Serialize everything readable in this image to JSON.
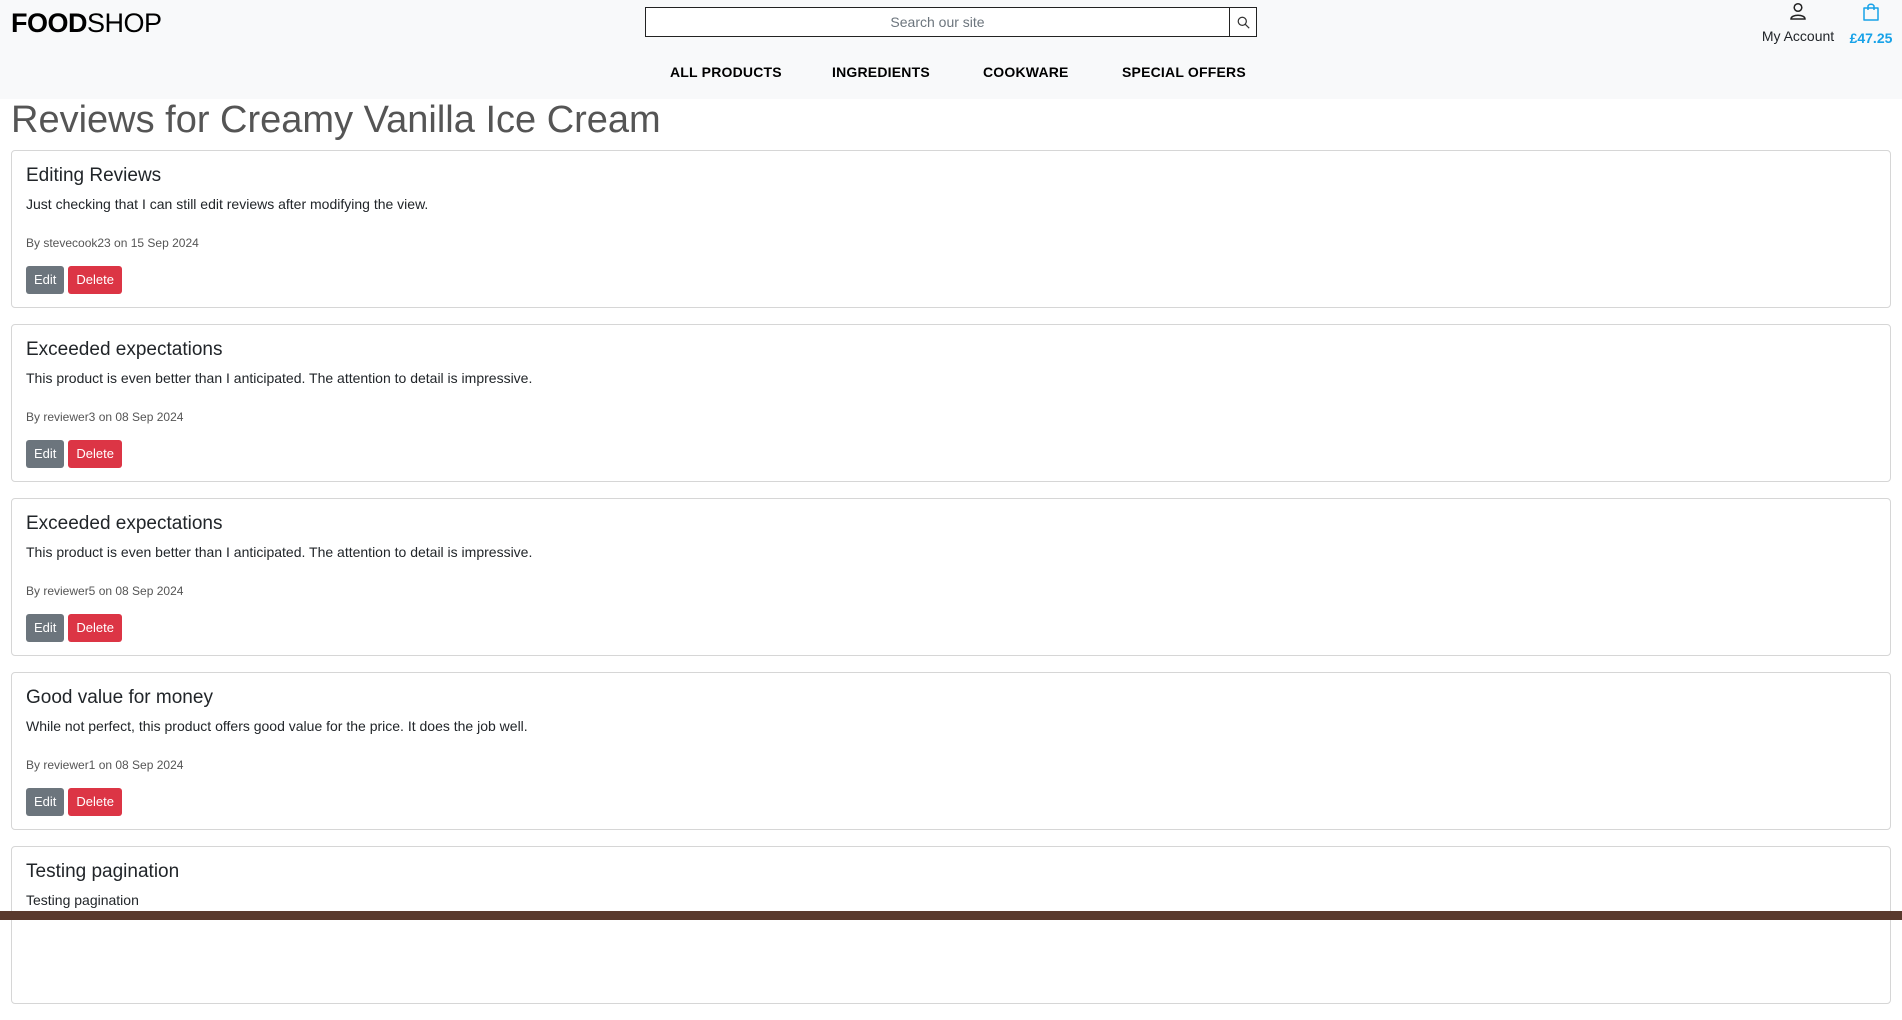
{
  "brand": {
    "bold": "FOOD",
    "light": "SHOP"
  },
  "search": {
    "placeholder": "Search our site",
    "icon": "search-icon"
  },
  "account": {
    "label": "My Account",
    "icon": "user-icon"
  },
  "bag": {
    "total": "£47.25",
    "icon": "shopping-bag-icon",
    "color": "#17a2e8"
  },
  "nav": {
    "items": [
      {
        "label": "ALL PRODUCTS"
      },
      {
        "label": "INGREDIENTS"
      },
      {
        "label": "COOKWARE"
      },
      {
        "label": "SPECIAL OFFERS"
      }
    ]
  },
  "page": {
    "title": "Reviews for Creamy Vanilla Ice Cream"
  },
  "buttons": {
    "edit": "Edit",
    "delete": "Delete"
  },
  "reviews": [
    {
      "title": "Editing Reviews",
      "body": "Just checking that I can still edit reviews after modifying the view.",
      "meta": "By stevecook23 on 15 Sep 2024"
    },
    {
      "title": "Exceeded expectations",
      "body": "This product is even better than I anticipated. The attention to detail is impressive.",
      "meta": "By reviewer3 on 08 Sep 2024"
    },
    {
      "title": "Exceeded expectations",
      "body": "This product is even better than I anticipated. The attention to detail is impressive.",
      "meta": "By reviewer5 on 08 Sep 2024"
    },
    {
      "title": "Good value for money",
      "body": "While not perfect, this product offers good value for the price. It does the job well.",
      "meta": "By reviewer1 on 08 Sep 2024"
    },
    {
      "title": "Testing pagination",
      "body": "Testing pagination",
      "meta": ""
    }
  ],
  "colors": {
    "edit": "#6c757d",
    "delete": "#dc3545",
    "header_bg": "#f8f9fa"
  }
}
